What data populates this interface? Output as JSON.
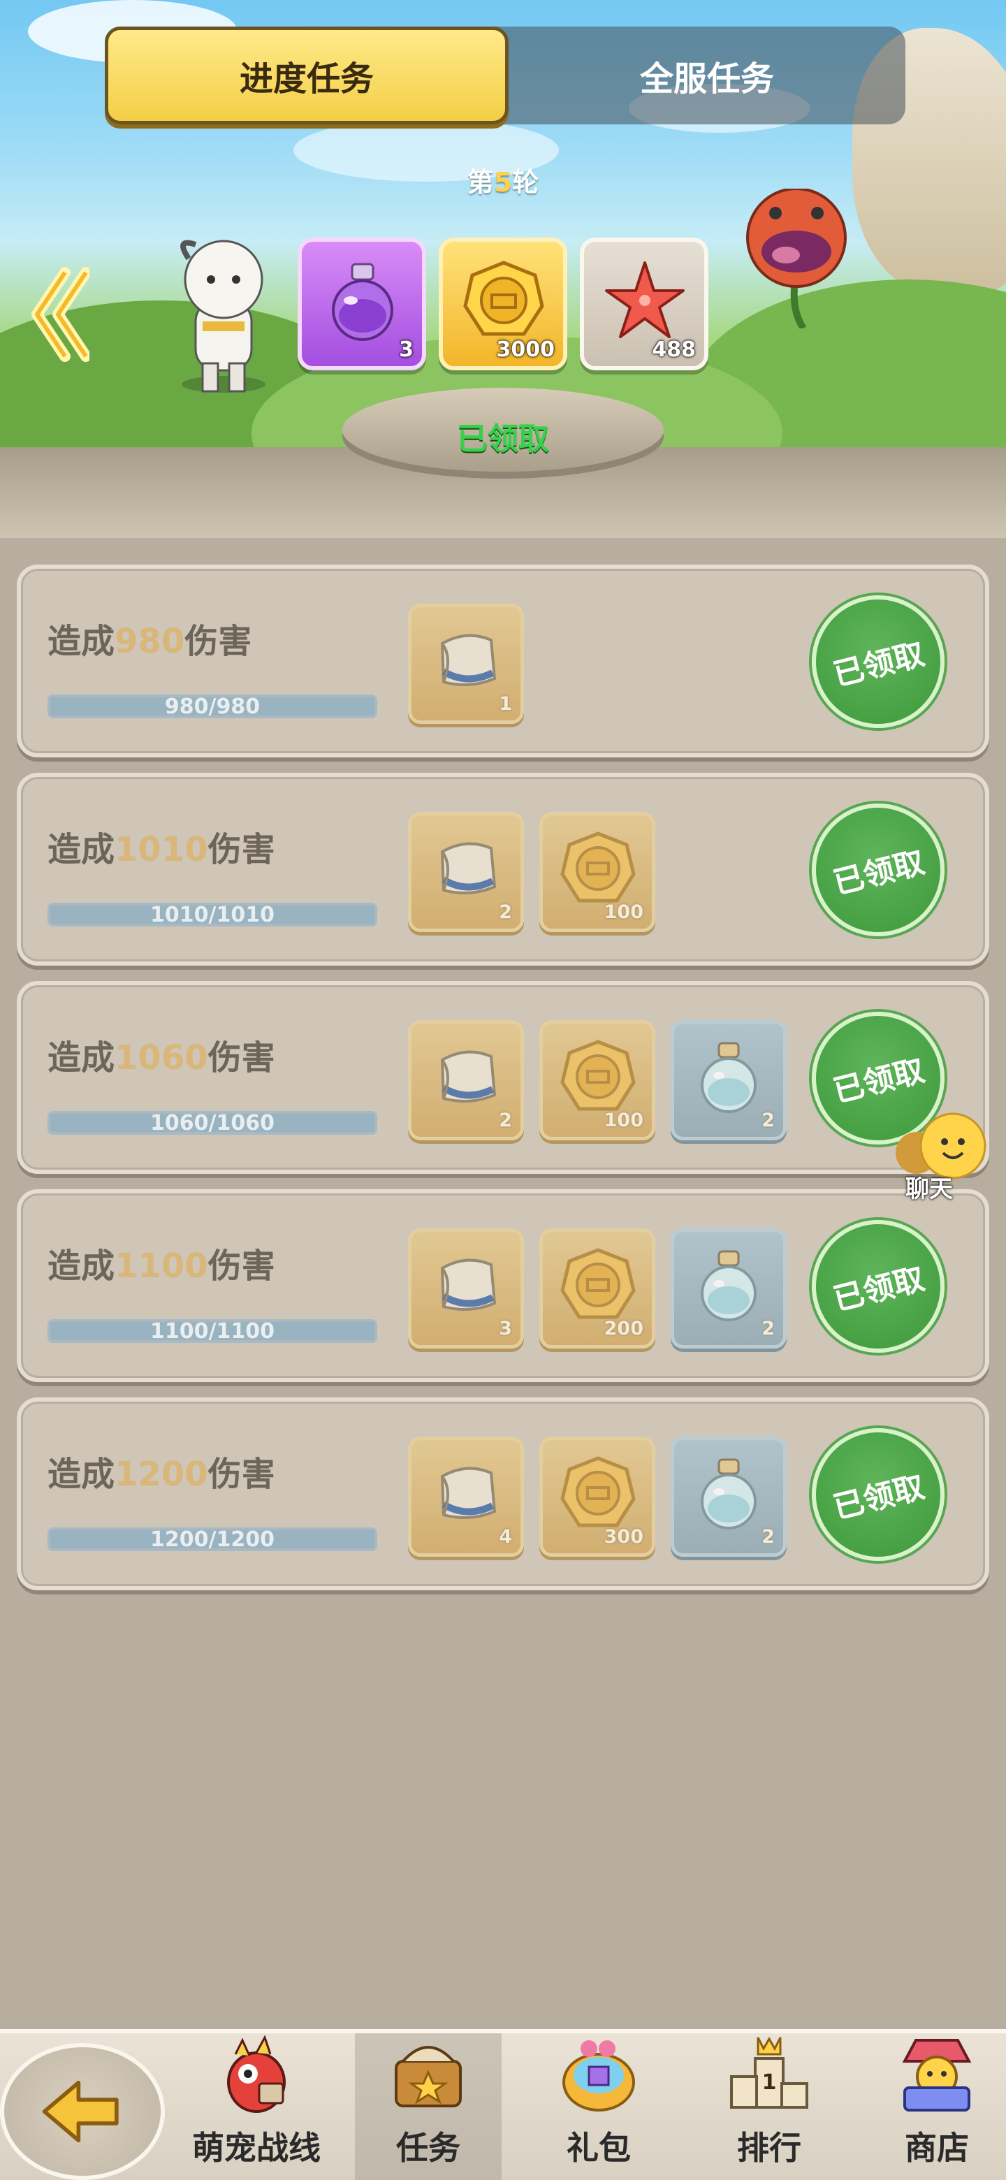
{
  "tabs": [
    {
      "label": "进度任务",
      "active": true
    },
    {
      "label": "全服任务",
      "active": false
    }
  ],
  "round": {
    "prefix": "第",
    "number": "5",
    "suffix": "轮"
  },
  "round_rewards": [
    {
      "icon": "purple-potion-icon",
      "qty": "3"
    },
    {
      "icon": "gold-coin-icon",
      "qty": "3000"
    },
    {
      "icon": "red-starfish-icon",
      "qty": "488"
    }
  ],
  "round_status": "已领取",
  "tasks": [
    {
      "prefix": "造成",
      "amount": "980",
      "suffix": "伤害",
      "progress_text": "980/980",
      "progress": 1.0,
      "rewards": [
        {
          "icon": "scroll-icon",
          "qty": "1"
        }
      ],
      "button": "已领取"
    },
    {
      "prefix": "造成",
      "amount": "1010",
      "suffix": "伤害",
      "progress_text": "1010/1010",
      "progress": 1.0,
      "rewards": [
        {
          "icon": "scroll-icon",
          "qty": "2"
        },
        {
          "icon": "gold-coin-icon",
          "qty": "100"
        }
      ],
      "button": "已领取"
    },
    {
      "prefix": "造成",
      "amount": "1060",
      "suffix": "伤害",
      "progress_text": "1060/1060",
      "progress": 1.0,
      "rewards": [
        {
          "icon": "scroll-icon",
          "qty": "2"
        },
        {
          "icon": "gold-coin-icon",
          "qty": "100"
        },
        {
          "icon": "potion-bottle-icon",
          "qty": "2"
        }
      ],
      "button": "已领取"
    },
    {
      "prefix": "造成",
      "amount": "1100",
      "suffix": "伤害",
      "progress_text": "1100/1100",
      "progress": 1.0,
      "rewards": [
        {
          "icon": "scroll-icon",
          "qty": "3"
        },
        {
          "icon": "gold-coin-icon",
          "qty": "200"
        },
        {
          "icon": "potion-bottle-icon",
          "qty": "2"
        }
      ],
      "button": "已领取"
    },
    {
      "prefix": "造成",
      "amount": "1200",
      "suffix": "伤害",
      "progress_text": "1200/1200",
      "progress": 1.0,
      "rewards": [
        {
          "icon": "scroll-icon",
          "qty": "4"
        },
        {
          "icon": "gold-coin-icon",
          "qty": "300"
        },
        {
          "icon": "potion-bottle-icon",
          "qty": "2"
        }
      ],
      "button": "已领取"
    }
  ],
  "chat": {
    "label": "聊天"
  },
  "nav": [
    {
      "label": "萌宠战线",
      "icon": "dragon-pet-icon",
      "active": false
    },
    {
      "label": "任务",
      "icon": "task-chest-icon",
      "active": true
    },
    {
      "label": "礼包",
      "icon": "gift-chest-icon",
      "active": false
    },
    {
      "label": "排行",
      "icon": "ranking-podium-icon",
      "active": false
    },
    {
      "label": "商店",
      "icon": "shop-merchant-icon",
      "active": false
    }
  ]
}
